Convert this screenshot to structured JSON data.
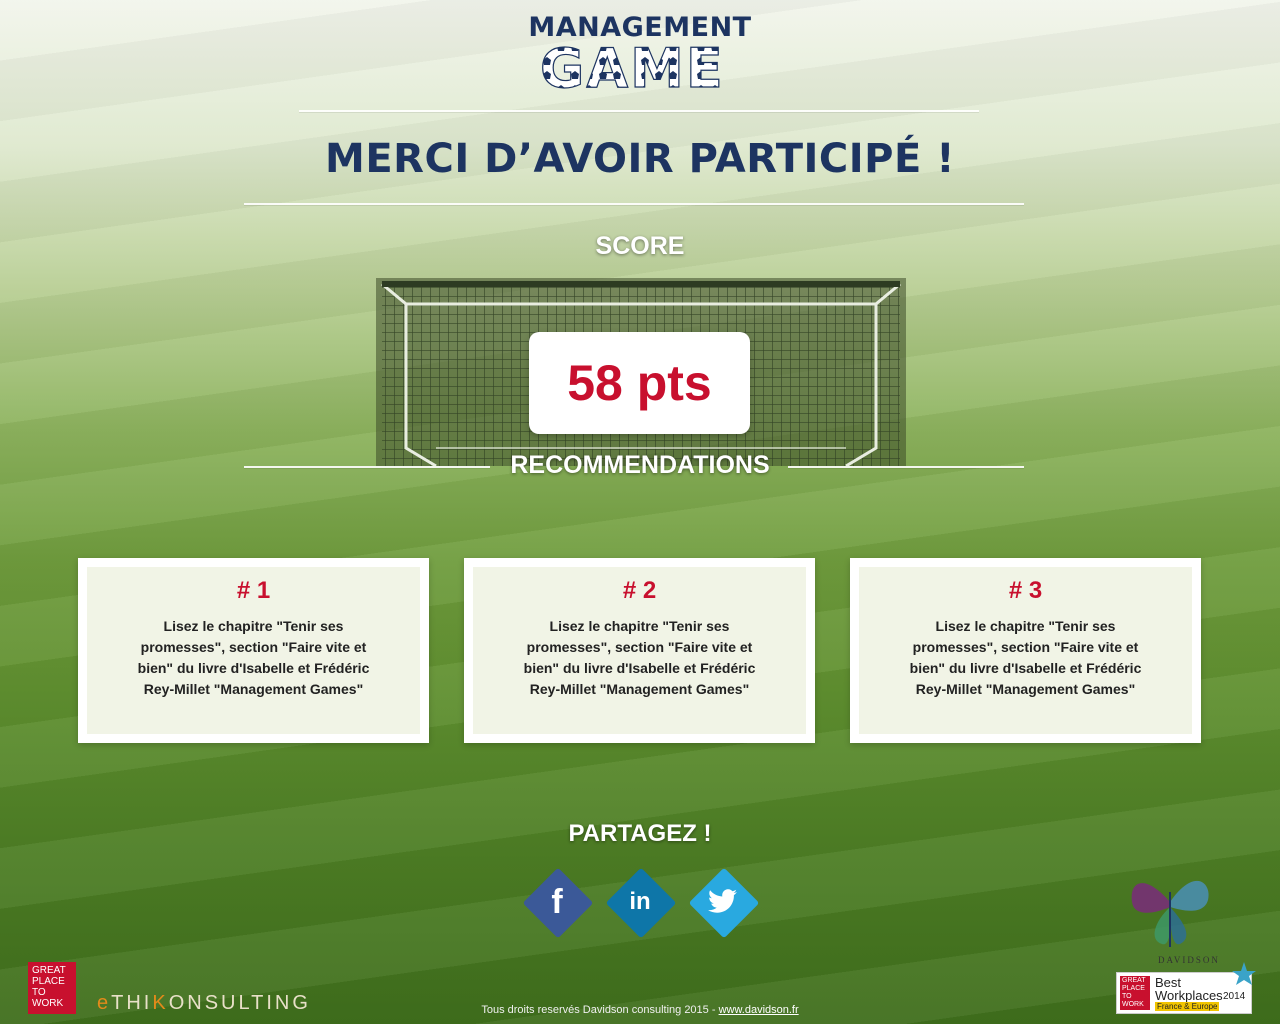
{
  "logo": {
    "line1": "MANAGEMENT",
    "line2": "GAME"
  },
  "heading": "MERCI D’AVOIR PARTICIPÉ !",
  "score": {
    "label": "SCORE",
    "value": "58 pts"
  },
  "recommendations": {
    "label": "RECOMMENDATIONS",
    "items": [
      {
        "title": "# 1",
        "text": "Lisez le chapitre  \"Tenir ses promesses\", section \"Faire vite et bien\" du livre d'Isabelle et Frédéric Rey-Millet \"Management Games\""
      },
      {
        "title": "# 2",
        "text": "Lisez le chapitre  \"Tenir ses promesses\", section \"Faire vite et bien\" du livre d'Isabelle et Frédéric Rey-Millet \"Management Games\""
      },
      {
        "title": "# 3",
        "text": "Lisez le chapitre  \"Tenir ses promesses\", section \"Faire vite et bien\" du livre d'Isabelle et Frédéric Rey-Millet \"Management Games\""
      }
    ]
  },
  "share": {
    "label": "PARTAGEZ !",
    "buttons": [
      {
        "name": "facebook",
        "glyph": "f",
        "color": "#3b5998"
      },
      {
        "name": "linkedin",
        "glyph": "in",
        "color": "#0e76a8"
      },
      {
        "name": "twitter",
        "glyph": "🐦",
        "color": "#29a9e0"
      }
    ]
  },
  "footer": {
    "text": "Tous droits reservés Davidson consulting 2015 - ",
    "link": "www.davidson.fr"
  },
  "badges": {
    "gptw_left": "GREAT PLACE TO WORK",
    "ethik": "eTHIKONSULTING",
    "davidson": "DAVIDSON",
    "gptw_small": "GREAT PLACE TO WORK",
    "best_workplaces": "Best Workplaces",
    "year": "2014",
    "region": "France & Europe"
  },
  "colors": {
    "navy": "#1d3461",
    "red": "#c8102e"
  }
}
